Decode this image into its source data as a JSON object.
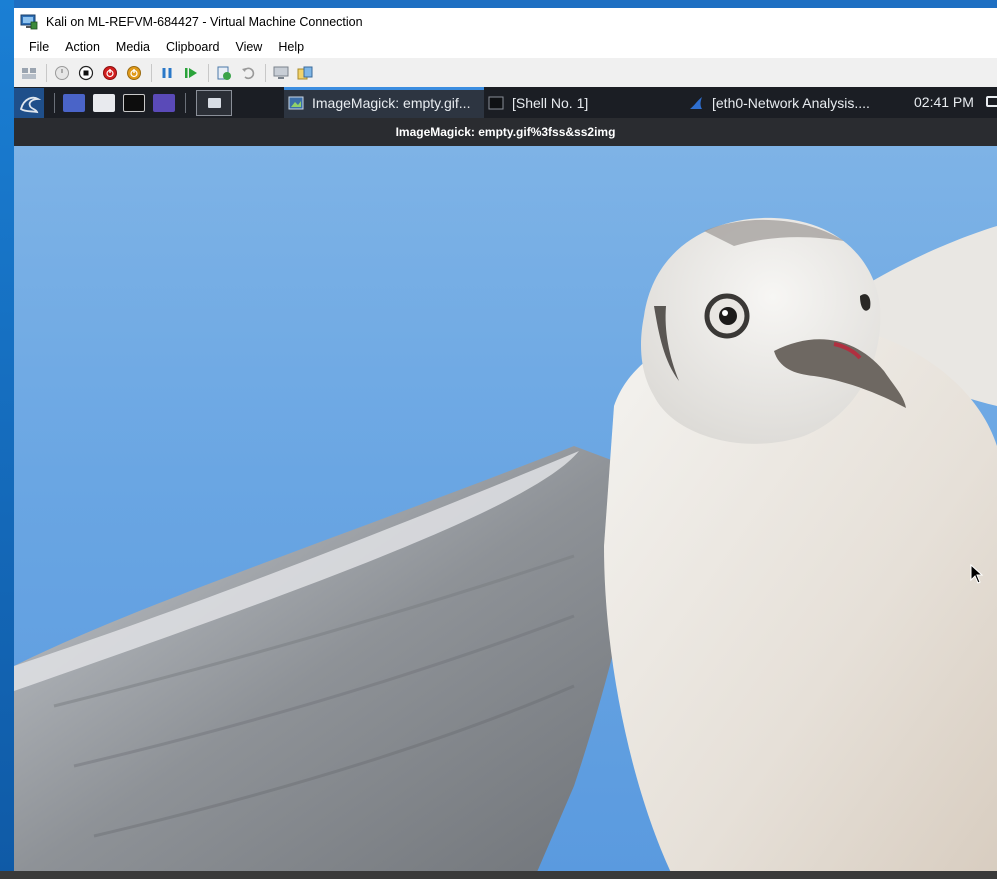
{
  "window": {
    "title": "Kali on ML-REFVM-684427 - Virtual Machine Connection"
  },
  "menubar": {
    "items": [
      "File",
      "Action",
      "Media",
      "Clipboard",
      "View",
      "Help"
    ]
  },
  "toolbar": {
    "buttons": [
      "ctrl-alt-del-icon",
      "start-icon",
      "turn-off-icon",
      "shut-down-icon",
      "save-icon",
      "pause-icon",
      "resume-icon",
      "checkpoint-icon",
      "revert-icon",
      "enhanced-session-icon",
      "share-icon"
    ]
  },
  "kali_panel": {
    "tasks": [
      {
        "label": "ImageMagick: empty.gif...",
        "active": true
      },
      {
        "label": "[Shell No. 1]",
        "active": false
      },
      {
        "label": "[eth0-Network Analysis....",
        "active": false
      }
    ],
    "clock": "02:41 PM"
  },
  "image_window": {
    "title": "ImageMagick: empty.gif%3fss&ss2img"
  },
  "colors": {
    "panel_bg": "#1b1e24",
    "active_task_accent": "#3b8de0",
    "sky": "#6aa6e3"
  }
}
